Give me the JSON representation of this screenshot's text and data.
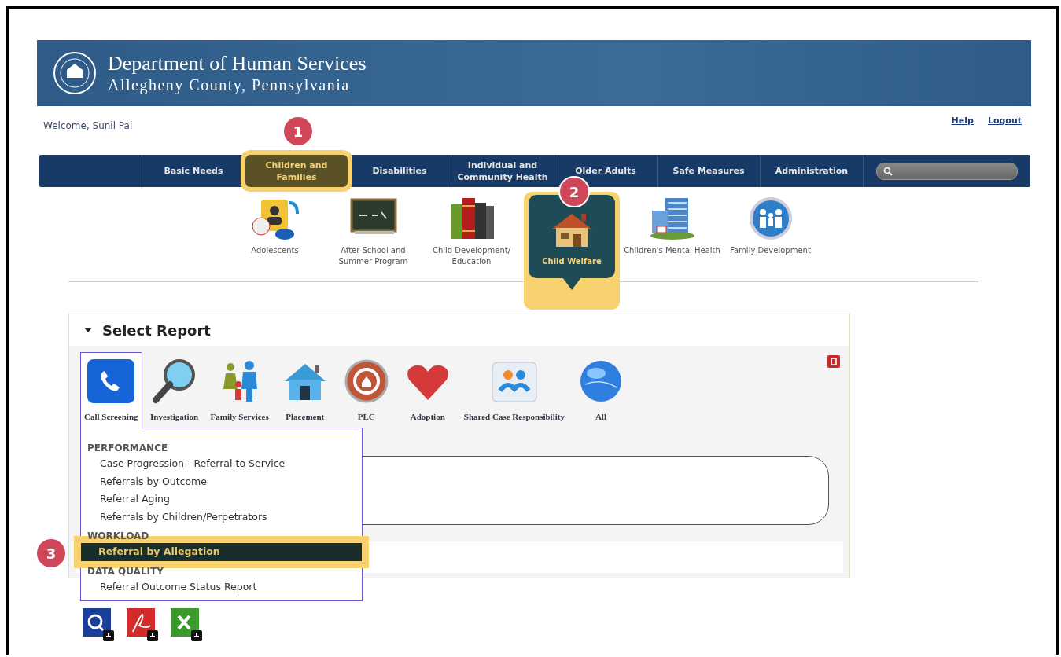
{
  "header": {
    "title": "Department of Human Services",
    "subtitle": "Allegheny County, Pennsylvania"
  },
  "user_bar": {
    "welcome": "Welcome, Sunil Pai",
    "links": [
      "Help",
      "Logout"
    ]
  },
  "nav": {
    "items": [
      {
        "label": "Basic Needs",
        "selected": false
      },
      {
        "label": "Children and Families",
        "selected": true,
        "callout": "1"
      },
      {
        "label": "Disabilities",
        "selected": false
      },
      {
        "label": "Individual and Community Health",
        "selected": false
      },
      {
        "label": "Older Adults",
        "selected": false
      },
      {
        "label": "Safe Measures",
        "selected": false
      },
      {
        "label": "Administration",
        "selected": false
      }
    ]
  },
  "categories": [
    {
      "label": "Adolescents",
      "selected": false
    },
    {
      "label": "After School and Summer Program",
      "selected": false
    },
    {
      "label": "Child Development/ Education",
      "selected": false
    },
    {
      "label": "Child Welfare",
      "selected": true,
      "callout": "2"
    },
    {
      "label": "Children's Mental Health",
      "selected": false
    },
    {
      "label": "Family Development",
      "selected": false
    }
  ],
  "report_panel": {
    "title": "Select Report",
    "expanded": true,
    "report_types": [
      {
        "label": "Call Screening",
        "selected": true
      },
      {
        "label": "Investigation",
        "selected": false
      },
      {
        "label": "Family Services",
        "selected": false
      },
      {
        "label": "Placement",
        "selected": false
      },
      {
        "label": "PLC",
        "selected": false
      },
      {
        "label": "Adoption",
        "selected": false
      },
      {
        "label": "Shared Case Responsibility",
        "selected": false
      },
      {
        "label": "All",
        "selected": false
      }
    ],
    "menu": [
      {
        "heading": "PERFORMANCE",
        "items": [
          {
            "label": "Case Progression - Referral to Service",
            "selected": false
          },
          {
            "label": "Referrals by Outcome",
            "selected": false
          },
          {
            "label": "Referral Aging",
            "selected": false
          },
          {
            "label": "Referrals by Children/Perpetrators",
            "selected": false
          }
        ]
      },
      {
        "heading": "WORKLOAD",
        "items": [
          {
            "label": "Referral by Allegation",
            "selected": true,
            "callout": "3"
          }
        ]
      },
      {
        "heading": "DATA QUALITY",
        "items": [
          {
            "label": "Referral Outcome Status Report",
            "selected": false
          }
        ]
      }
    ]
  }
}
